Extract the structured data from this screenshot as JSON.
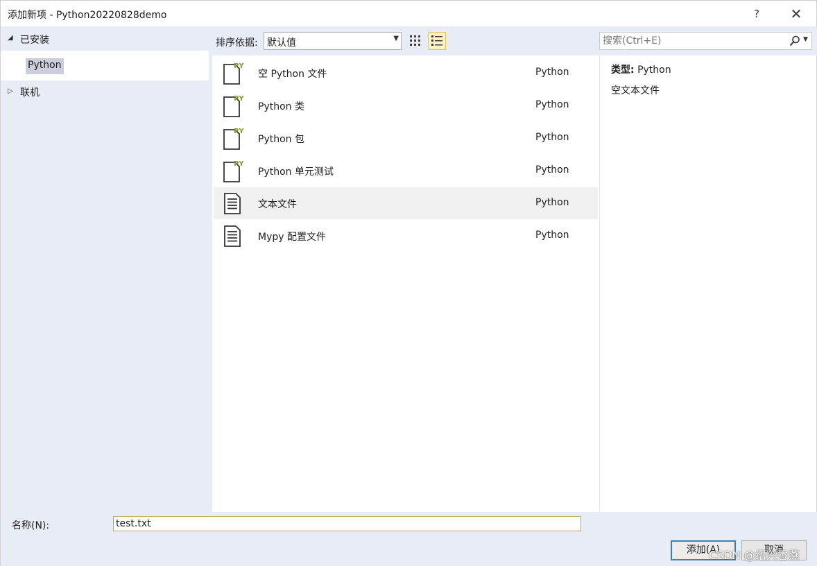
{
  "window": {
    "title": "添加新项 - Python20220828demo",
    "help_label": "?",
    "close_label": "✕"
  },
  "tree": {
    "installed": {
      "label": "已安装",
      "expanded": true,
      "child": "Python"
    },
    "online": {
      "label": "联机",
      "expanded": false
    }
  },
  "toolbar": {
    "sort_label": "排序依据:",
    "sort_value": "默认值",
    "active_view": "list"
  },
  "search": {
    "placeholder": "搜索(Ctrl+E)"
  },
  "items": [
    {
      "name": "空 Python 文件",
      "lang": "Python",
      "icon": "python-file-icon"
    },
    {
      "name": "Python 类",
      "lang": "Python",
      "icon": "python-file-icon"
    },
    {
      "name": "Python 包",
      "lang": "Python",
      "icon": "python-file-icon"
    },
    {
      "name": "Python 单元测试",
      "lang": "Python",
      "icon": "python-file-icon"
    },
    {
      "name": "文本文件",
      "lang": "Python",
      "icon": "text-file-icon",
      "selected": true
    },
    {
      "name": "Mypy 配置文件",
      "lang": "Python",
      "icon": "text-file-icon"
    }
  ],
  "details": {
    "type_label": "类型:",
    "type_value": "Python",
    "description": "空文本文件"
  },
  "footer": {
    "name_label": "名称(N):",
    "name_value": "test.txt",
    "add_label": "添加(A)",
    "cancel_label": "取消"
  },
  "watermark": "CSDN @绍兴香燕",
  "colors": {
    "pane_bg": "#e8ecf5",
    "selection_bg": "#cccedb",
    "py_badge": "#7ba22a",
    "active_view_bg": "#fdf4bf"
  }
}
